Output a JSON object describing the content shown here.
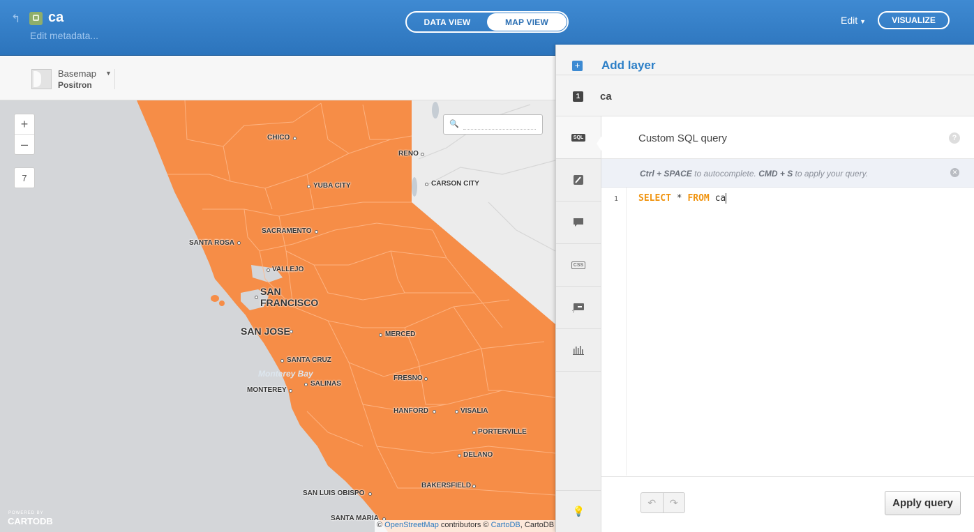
{
  "header": {
    "title": "ca",
    "edit_metadata": "Edit metadata...",
    "tabs": [
      {
        "label": "DATA VIEW",
        "active": false
      },
      {
        "label": "MAP VIEW",
        "active": true
      }
    ],
    "edit_menu": "Edit",
    "visualize_button": "VISUALIZE"
  },
  "toolbar": {
    "basemap_label": "Basemap",
    "basemap_value": "Positron"
  },
  "map": {
    "zoom_in": "+",
    "zoom_out": "–",
    "zoom_level": "7",
    "fill_color": "#f68d47",
    "cities": [
      {
        "name": "CHICO"
      },
      {
        "name": "RENO"
      },
      {
        "name": "YUBA CITY"
      },
      {
        "name": "CARSON CITY"
      },
      {
        "name": "SACRAMENTO"
      },
      {
        "name": "SANTA ROSA"
      },
      {
        "name": "VALLEJO"
      },
      {
        "name": "SAN"
      },
      {
        "name": "FRANCISCO"
      },
      {
        "name": "SAN JOSE"
      },
      {
        "name": "MERCED"
      },
      {
        "name": "SANTA CRUZ"
      },
      {
        "name": "SALINAS"
      },
      {
        "name": "FRESNO"
      },
      {
        "name": "MONTEREY"
      },
      {
        "name": "HANFORD"
      },
      {
        "name": "VISALIA"
      },
      {
        "name": "PORTERVILLE"
      },
      {
        "name": "DELANO"
      },
      {
        "name": "BAKERSFIELD"
      },
      {
        "name": "SAN LUIS OBISPO"
      },
      {
        "name": "SANTA MARIA"
      }
    ],
    "bay_label": "Monterey Bay",
    "attribution": {
      "prefix": "© ",
      "osm": "OpenStreetMap",
      "middle": " contributors © ",
      "cartodb": "CartoDB",
      "suffix": ", CartoDB"
    },
    "powered_by": "POWERED BY",
    "logo": "CARTODB"
  },
  "panel": {
    "add_layer": "Add layer",
    "layer_number": "1",
    "layer_name": "ca",
    "side_tabs": [
      {
        "name": "sql",
        "icon": "sql-icon",
        "label": "SQL"
      },
      {
        "name": "wizard",
        "icon": "brush-icon"
      },
      {
        "name": "infowindow",
        "icon": "speech-bubble-icon"
      },
      {
        "name": "css",
        "icon": "css-icon",
        "label": "CSS"
      },
      {
        "name": "legends",
        "icon": "legend-icon"
      },
      {
        "name": "filters",
        "icon": "histogram-icon"
      }
    ],
    "editor": {
      "title": "Custom SQL query",
      "help": "?",
      "hint_key1": "Ctrl + SPACE",
      "hint_text1": " to autocomplete. ",
      "hint_key2": "CMD + S",
      "hint_text2": " to apply your query.",
      "line_number": "1",
      "sql_select": "SELECT",
      "sql_star": " * ",
      "sql_from": "FROM",
      "sql_table": " ca",
      "apply_button": "Apply query",
      "undo": "↶",
      "redo": "↷"
    }
  }
}
